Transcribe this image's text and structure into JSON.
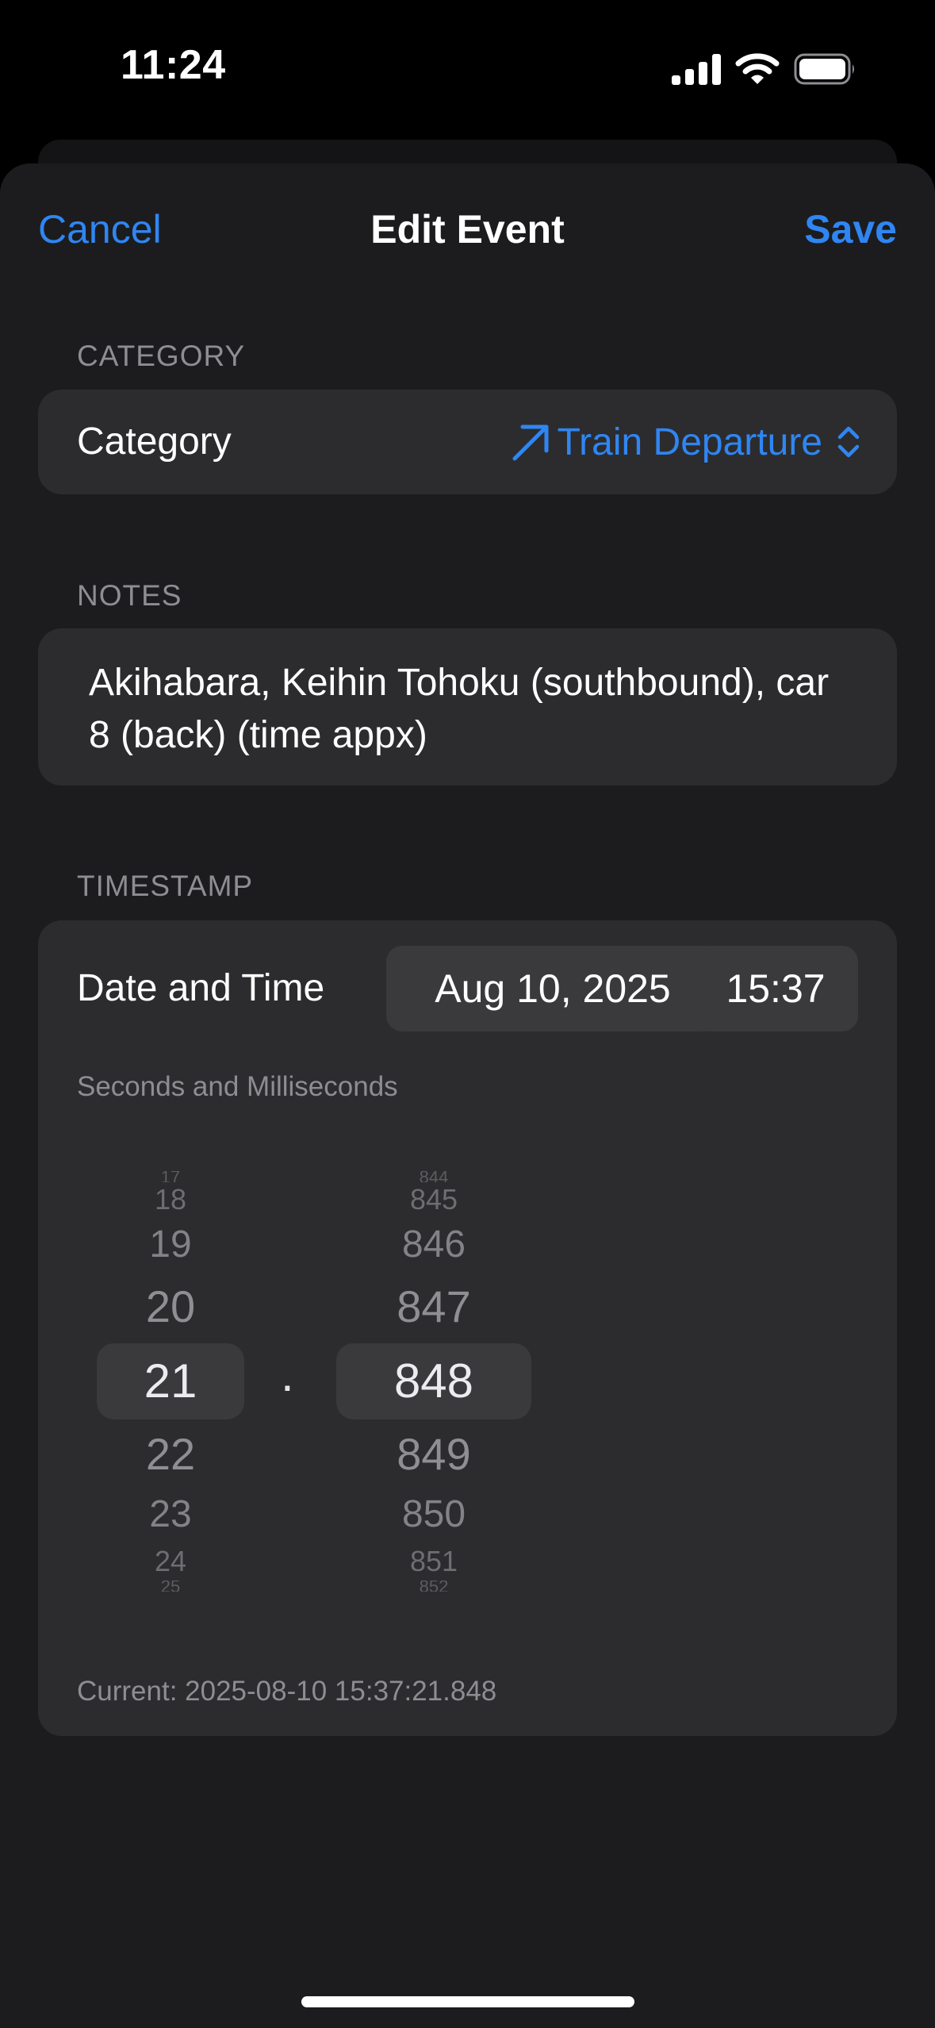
{
  "status_bar": {
    "time": "11:24",
    "icons": [
      "cellular-signal-icon",
      "wifi-icon",
      "battery-icon"
    ]
  },
  "nav": {
    "cancel_label": "Cancel",
    "title": "Edit Event",
    "save_label": "Save"
  },
  "category_section": {
    "header": "CATEGORY",
    "row_label": "Category",
    "value": "Train Departure",
    "value_icon": "arrow-up-right-icon",
    "picker_icon": "chevron-up-down-icon"
  },
  "notes_section": {
    "header": "NOTES",
    "text": "Akihabara, Keihin Tohoku (southbound), car 8 (back) (time appx)"
  },
  "timestamp_section": {
    "header": "TIMESTAMP",
    "row_label": "Date and Time",
    "date_value": "Aug 10, 2025",
    "time_value": "15:37",
    "subheader": "Seconds and Milliseconds",
    "seconds_wheel": {
      "items": [
        "17",
        "18",
        "19",
        "20",
        "21",
        "22",
        "23",
        "24",
        "25"
      ],
      "selected": "21"
    },
    "separator": ".",
    "milliseconds_wheel": {
      "items": [
        "844",
        "845",
        "846",
        "847",
        "848",
        "849",
        "850",
        "851",
        "852"
      ],
      "selected": "848"
    },
    "current_text": "Current: 2025-08-10 15:37:21.848"
  },
  "colors": {
    "accent": "#2f86f2",
    "sheet_background": "#1c1c1e",
    "card_background": "#2c2c2e",
    "secondary_text": "#8d8d93"
  }
}
